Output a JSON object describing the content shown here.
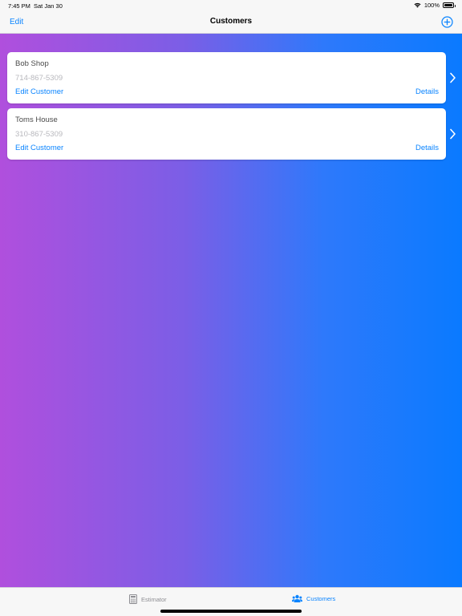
{
  "status_bar": {
    "time": "7:45 PM",
    "date": "Sat Jan 30",
    "battery": "100%",
    "icons": [
      "wifi-icon",
      "battery-icon"
    ]
  },
  "nav": {
    "edit_label": "Edit",
    "title": "Customers",
    "add_icon": "plus-circle-icon"
  },
  "customers": [
    {
      "name": "Bob Shop",
      "phone": "714-867-5309",
      "edit_label": "Edit Customer",
      "details_label": "Details"
    },
    {
      "name": "Toms House",
      "phone": "310-867-5309",
      "edit_label": "Edit Customer",
      "details_label": "Details"
    }
  ],
  "tab_bar": {
    "tabs": [
      {
        "label": "Estimator",
        "icon": "calculator-icon",
        "selected": false
      },
      {
        "label": "Customers",
        "icon": "people-icon",
        "selected": true
      }
    ]
  },
  "colors": {
    "accent": "#0a84ff",
    "gradient_start": "#b04fdd",
    "gradient_end": "#0a7aff"
  }
}
